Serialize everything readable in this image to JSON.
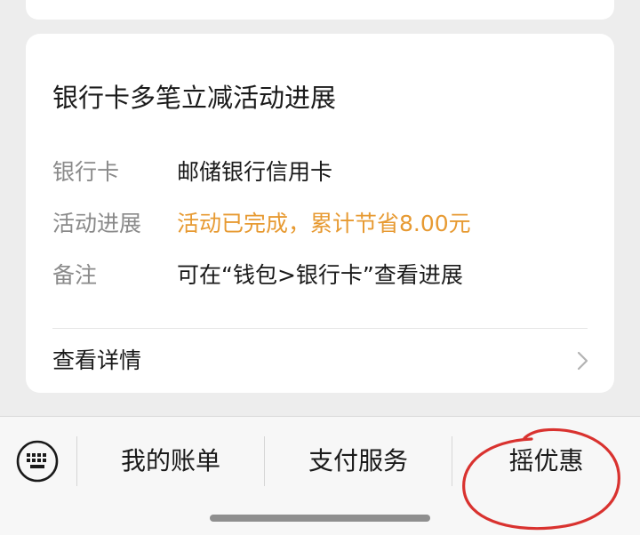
{
  "card": {
    "title": "银行卡多笔立减活动进展",
    "rows": [
      {
        "label": "银行卡",
        "value": "邮储银行信用卡"
      },
      {
        "label": "活动进展",
        "value": "活动已完成，累计节省8.00元"
      },
      {
        "label": "备注",
        "value": "可在“钱包>银行卡”查看进展"
      }
    ],
    "details_label": "查看详情"
  },
  "bottom_menu": {
    "items": [
      {
        "label": "我的账单"
      },
      {
        "label": "支付服务"
      },
      {
        "label": "摇优惠"
      }
    ]
  },
  "icons": {
    "keyboard": "keyboard-icon",
    "chevron": "chevron-right-icon"
  },
  "colors": {
    "highlight": "#e79a32",
    "annotation": "#d9322f"
  }
}
